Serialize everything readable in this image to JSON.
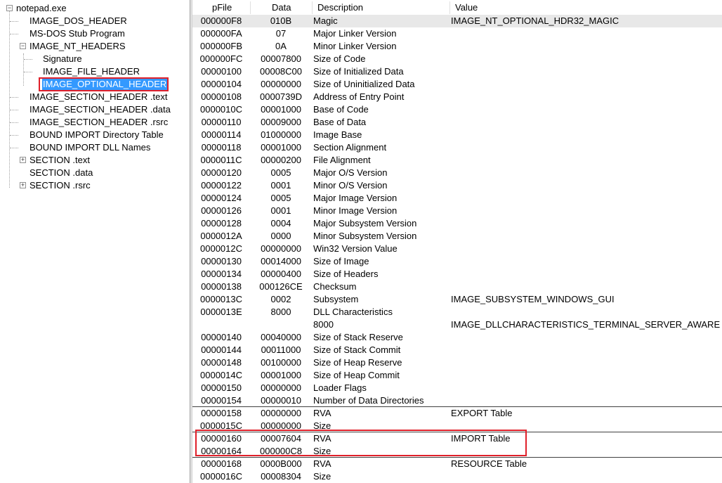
{
  "tree": {
    "root": "notepad.exe",
    "dos_header": "IMAGE_DOS_HEADER",
    "dos_stub": "MS-DOS Stub Program",
    "nt_headers": "IMAGE_NT_HEADERS",
    "signature": "Signature",
    "file_header": "IMAGE_FILE_HEADER",
    "optional_header": "IMAGE_OPTIONAL_HEADER",
    "section_header_text": "IMAGE_SECTION_HEADER .text",
    "section_header_data": "IMAGE_SECTION_HEADER .data",
    "section_header_rsrc": "IMAGE_SECTION_HEADER .rsrc",
    "bound_import_dir": "BOUND IMPORT Directory Table",
    "bound_import_names": "BOUND IMPORT DLL Names",
    "section_text": "SECTION .text",
    "section_data": "SECTION .data",
    "section_rsrc": "SECTION .rsrc"
  },
  "columns": {
    "pfile": "pFile",
    "data": "Data",
    "desc": "Description",
    "value": "Value"
  },
  "rows": [
    {
      "pfile": "000000F8",
      "data": "010B",
      "desc": "Magic",
      "value": "IMAGE_NT_OPTIONAL_HDR32_MAGIC"
    },
    {
      "pfile": "000000FA",
      "data": "07",
      "desc": "Major Linker Version",
      "value": ""
    },
    {
      "pfile": "000000FB",
      "data": "0A",
      "desc": "Minor Linker Version",
      "value": ""
    },
    {
      "pfile": "000000FC",
      "data": "00007800",
      "desc": "Size of Code",
      "value": ""
    },
    {
      "pfile": "00000100",
      "data": "00008C00",
      "desc": "Size of Initialized Data",
      "value": ""
    },
    {
      "pfile": "00000104",
      "data": "00000000",
      "desc": "Size of Uninitialized Data",
      "value": ""
    },
    {
      "pfile": "00000108",
      "data": "0000739D",
      "desc": "Address of Entry Point",
      "value": ""
    },
    {
      "pfile": "0000010C",
      "data": "00001000",
      "desc": "Base of Code",
      "value": ""
    },
    {
      "pfile": "00000110",
      "data": "00009000",
      "desc": "Base of Data",
      "value": ""
    },
    {
      "pfile": "00000114",
      "data": "01000000",
      "desc": "Image Base",
      "value": ""
    },
    {
      "pfile": "00000118",
      "data": "00001000",
      "desc": "Section Alignment",
      "value": ""
    },
    {
      "pfile": "0000011C",
      "data": "00000200",
      "desc": "File Alignment",
      "value": ""
    },
    {
      "pfile": "00000120",
      "data": "0005",
      "desc": "Major O/S Version",
      "value": ""
    },
    {
      "pfile": "00000122",
      "data": "0001",
      "desc": "Minor O/S Version",
      "value": ""
    },
    {
      "pfile": "00000124",
      "data": "0005",
      "desc": "Major Image Version",
      "value": ""
    },
    {
      "pfile": "00000126",
      "data": "0001",
      "desc": "Minor Image Version",
      "value": ""
    },
    {
      "pfile": "00000128",
      "data": "0004",
      "desc": "Major Subsystem Version",
      "value": ""
    },
    {
      "pfile": "0000012A",
      "data": "0000",
      "desc": "Minor Subsystem Version",
      "value": ""
    },
    {
      "pfile": "0000012C",
      "data": "00000000",
      "desc": "Win32 Version Value",
      "value": ""
    },
    {
      "pfile": "00000130",
      "data": "00014000",
      "desc": "Size of Image",
      "value": ""
    },
    {
      "pfile": "00000134",
      "data": "00000400",
      "desc": "Size of Headers",
      "value": ""
    },
    {
      "pfile": "00000138",
      "data": "000126CE",
      "desc": "Checksum",
      "value": ""
    },
    {
      "pfile": "0000013C",
      "data": "0002",
      "desc": "Subsystem",
      "value": "IMAGE_SUBSYSTEM_WINDOWS_GUI"
    },
    {
      "pfile": "0000013E",
      "data": "8000",
      "desc": "DLL Characteristics",
      "value": ""
    },
    {
      "pfile": "",
      "data": "",
      "desc": "8000",
      "value": "IMAGE_DLLCHARACTERISTICS_TERMINAL_SERVER_AWARE"
    },
    {
      "pfile": "00000140",
      "data": "00040000",
      "desc": "Size of Stack Reserve",
      "value": ""
    },
    {
      "pfile": "00000144",
      "data": "00011000",
      "desc": "Size of Stack Commit",
      "value": ""
    },
    {
      "pfile": "00000148",
      "data": "00100000",
      "desc": "Size of Heap Reserve",
      "value": ""
    },
    {
      "pfile": "0000014C",
      "data": "00001000",
      "desc": "Size of Heap Commit",
      "value": ""
    },
    {
      "pfile": "00000150",
      "data": "00000000",
      "desc": "Loader Flags",
      "value": ""
    },
    {
      "pfile": "00000154",
      "data": "00000010",
      "desc": "Number of Data Directories",
      "value": ""
    },
    {
      "pfile": "00000158",
      "data": "00000000",
      "desc": "RVA",
      "value": "EXPORT Table"
    },
    {
      "pfile": "0000015C",
      "data": "00000000",
      "desc": "Size",
      "value": ""
    },
    {
      "pfile": "00000160",
      "data": "00007604",
      "desc": "RVA",
      "value": "IMPORT Table"
    },
    {
      "pfile": "00000164",
      "data": "000000C8",
      "desc": "Size",
      "value": ""
    },
    {
      "pfile": "00000168",
      "data": "0000B000",
      "desc": "RVA",
      "value": "RESOURCE Table"
    },
    {
      "pfile": "0000016C",
      "data": "00008304",
      "desc": "Size",
      "value": ""
    }
  ]
}
